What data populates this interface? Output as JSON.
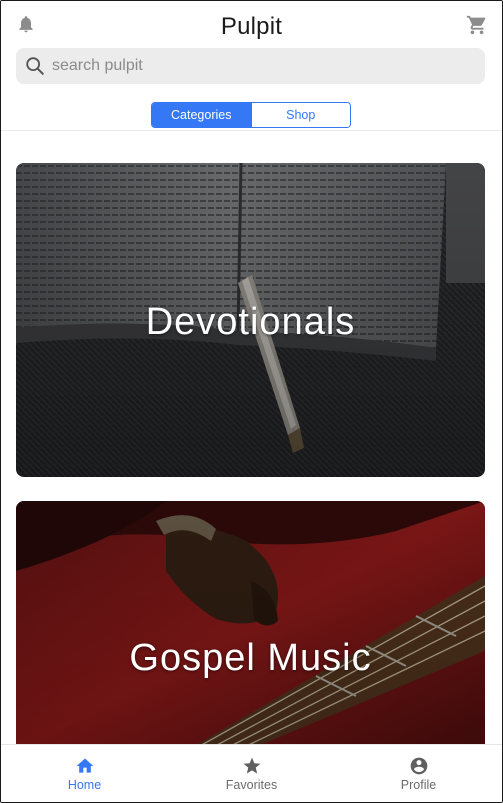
{
  "header": {
    "title": "Pulpit",
    "left_icon": "bell-icon",
    "right_icon": "cart-icon"
  },
  "search": {
    "placeholder": "search pulpit",
    "value": ""
  },
  "tabs": [
    {
      "label": "Categories",
      "active": true
    },
    {
      "label": "Shop",
      "active": false
    }
  ],
  "categories": [
    {
      "title": "Devotionals",
      "image": "open bible with pen"
    },
    {
      "title": "Gospel Music",
      "image": "hands playing red bass guitar"
    }
  ],
  "bottom_nav": [
    {
      "label": "Home",
      "icon": "home-icon",
      "active": true
    },
    {
      "label": "Favorites",
      "icon": "star-icon",
      "active": false
    },
    {
      "label": "Profile",
      "icon": "account-circle-icon",
      "active": false
    }
  ],
  "colors": {
    "accent": "#3478f6",
    "search_bg": "#ececec",
    "nav_inactive": "#6b6b6b"
  }
}
